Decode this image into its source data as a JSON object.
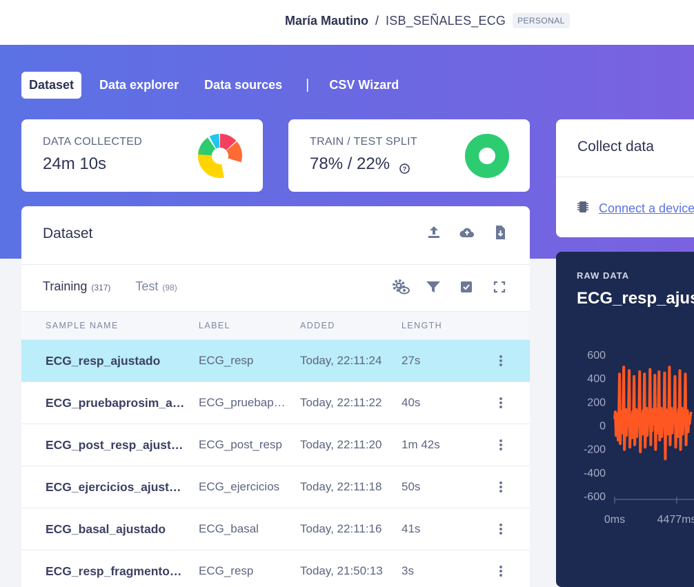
{
  "header": {
    "user": "María Mautino",
    "separator": "/",
    "project": "ISB_SEÑALES_ECG",
    "badge": "PERSONAL"
  },
  "nav": {
    "tabs": [
      {
        "label": "Dataset",
        "active": true
      },
      {
        "label": "Data explorer",
        "active": false
      },
      {
        "label": "Data sources",
        "active": false
      },
      {
        "label": "CSV Wizard",
        "active": false
      }
    ],
    "divider": "|"
  },
  "stats": {
    "collected": {
      "label": "DATA COLLECTED",
      "value": "24m 10s"
    },
    "split": {
      "label": "TRAIN / TEST SPLIT",
      "value": "78% / 22%"
    }
  },
  "dataset": {
    "title": "Dataset",
    "tabs": [
      {
        "label": "Training",
        "count": "(317)",
        "active": true
      },
      {
        "label": "Test",
        "count": "(98)",
        "active": false
      }
    ],
    "columns": [
      "SAMPLE NAME",
      "LABEL",
      "ADDED",
      "LENGTH"
    ],
    "rows": [
      {
        "name": "ECG_resp_ajustado",
        "label": "ECG_resp",
        "added": "Today, 22:11:24",
        "length": "27s",
        "selected": true
      },
      {
        "name": "ECG_pruebaprosim_ajustado",
        "label": "ECG_pruebaprosim",
        "added": "Today, 22:11:22",
        "length": "40s",
        "selected": false
      },
      {
        "name": "ECG_post_resp_ajustado",
        "label": "ECG_post_resp",
        "added": "Today, 22:11:20",
        "length": "1m 42s",
        "selected": false
      },
      {
        "name": "ECG_ejercicios_ajustado",
        "label": "ECG_ejercicios",
        "added": "Today, 22:11:18",
        "length": "50s",
        "selected": false
      },
      {
        "name": "ECG_basal_ajustado",
        "label": "ECG_basal",
        "added": "Today, 22:11:16",
        "length": "41s",
        "selected": false
      },
      {
        "name": "ECG_resp_fragmento_ajustado",
        "label": "ECG_resp",
        "added": "Today, 21:50:13",
        "length": "3s",
        "selected": false
      }
    ]
  },
  "collect": {
    "title": "Collect data",
    "connect_label": "Connect a device"
  },
  "raw": {
    "label": "RAW DATA",
    "title": "ECG_resp_ajustado"
  },
  "chart_data": {
    "type": "line",
    "title": "ECG_resp_ajustado",
    "ylim": [
      -600,
      600
    ],
    "yticks": [
      600,
      400,
      200,
      0,
      -200,
      -400,
      -600
    ],
    "xticks": [
      "0ms",
      "4477ms"
    ],
    "series": [
      {
        "color": "#ff5722",
        "x": [
          0,
          50,
          100,
          150,
          200,
          250,
          300,
          350,
          400,
          450,
          500,
          550,
          600,
          650,
          700,
          750,
          800,
          850,
          900,
          950,
          1000,
          1050,
          1100,
          1150,
          1200,
          1250,
          1300,
          1350,
          1400,
          1450,
          1500,
          1550,
          1600,
          1650,
          1700,
          1750,
          1800,
          1850,
          1900,
          1950,
          2000,
          2050,
          2100,
          2150,
          2200,
          2250,
          2300,
          2350,
          2400,
          2450,
          2500,
          2550,
          2600,
          2650,
          2700,
          2750,
          2800,
          2850,
          2900,
          2950,
          3000,
          3050,
          3100,
          3150,
          3200,
          3250,
          3300,
          3350,
          3400,
          3450,
          3500,
          3550,
          3600,
          3650,
          3700,
          3750,
          3800,
          3850,
          3900,
          3950,
          4000,
          4050,
          4100,
          4150,
          4200,
          4250,
          4300,
          4350,
          4400,
          4450,
          4500,
          4550,
          4600,
          4650,
          4700,
          4750,
          4800,
          4850,
          4900,
          4950,
          5000,
          5050,
          5100,
          5150,
          5200,
          5250,
          5300,
          5350,
          5400,
          5450,
          5500
        ],
        "values": [
          60,
          120,
          -80,
          40,
          100,
          -120,
          60,
          440,
          -150,
          80,
          120,
          -60,
          150,
          500,
          -200,
          60,
          140,
          -80,
          50,
          20,
          160,
          470,
          -180,
          90,
          40,
          -100,
          120,
          60,
          420,
          -160,
          80,
          140,
          -90,
          60,
          120,
          60,
          460,
          -220,
          100,
          40,
          -70,
          130,
          50,
          440,
          -180,
          70,
          150,
          -80,
          40,
          110,
          80,
          480,
          -160,
          120,
          -40,
          140,
          60,
          20,
          430,
          -200,
          90,
          140,
          -60,
          120,
          460,
          -120,
          60,
          150,
          -90,
          40,
          100,
          80,
          450,
          -280,
          140,
          60,
          -70,
          130,
          40,
          500,
          -160,
          90,
          150,
          -60,
          80,
          120,
          60,
          420,
          -180,
          100,
          40,
          -90,
          140,
          60,
          470,
          -200,
          80,
          150,
          -70,
          50,
          120,
          90,
          440,
          -160,
          100,
          130,
          -50,
          60,
          20,
          80,
          120
        ]
      }
    ]
  }
}
